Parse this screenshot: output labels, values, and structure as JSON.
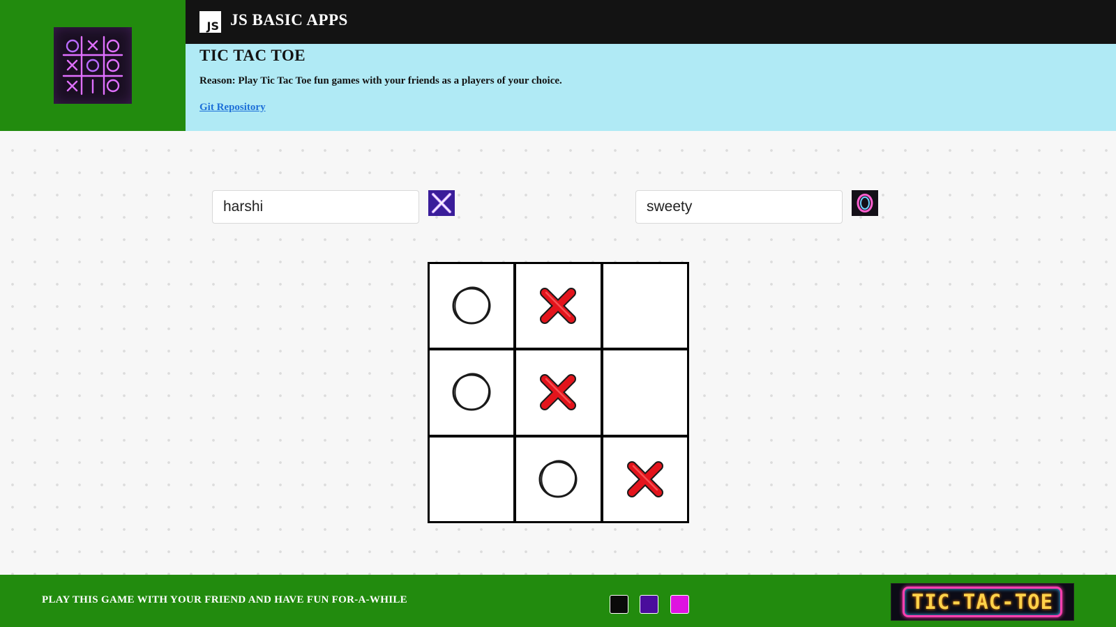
{
  "header": {
    "badge": "JS",
    "app_title": "JS BASIC APPS",
    "page_title": "TIC TAC TOE",
    "reason": "Reason: Play Tic Tac Toe fun games with your friends as a players of your choice.",
    "repo_link": "Git Repository"
  },
  "players": {
    "player1": {
      "value": "harshi",
      "symbol_icon": "neon-x-icon"
    },
    "player2": {
      "value": "sweety",
      "symbol_icon": "neon-o-icon"
    }
  },
  "board": {
    "cells": [
      "O",
      "X",
      "",
      "O",
      "X",
      "",
      "",
      "O",
      "X"
    ]
  },
  "footer": {
    "text": "PLAY THIS GAME WITH YOUR FRIEND AND HAVE FUN FOR-A-WHILE",
    "swatches": [
      "#0a0a0a",
      "#4a0d9c",
      "#de14e0"
    ],
    "banner": "TIC-TAC-TOE"
  },
  "colors": {
    "brand_green": "#228B0E",
    "info_panel": "#b0eaf5",
    "topbar": "#131313",
    "link": "#1c6fd8"
  }
}
